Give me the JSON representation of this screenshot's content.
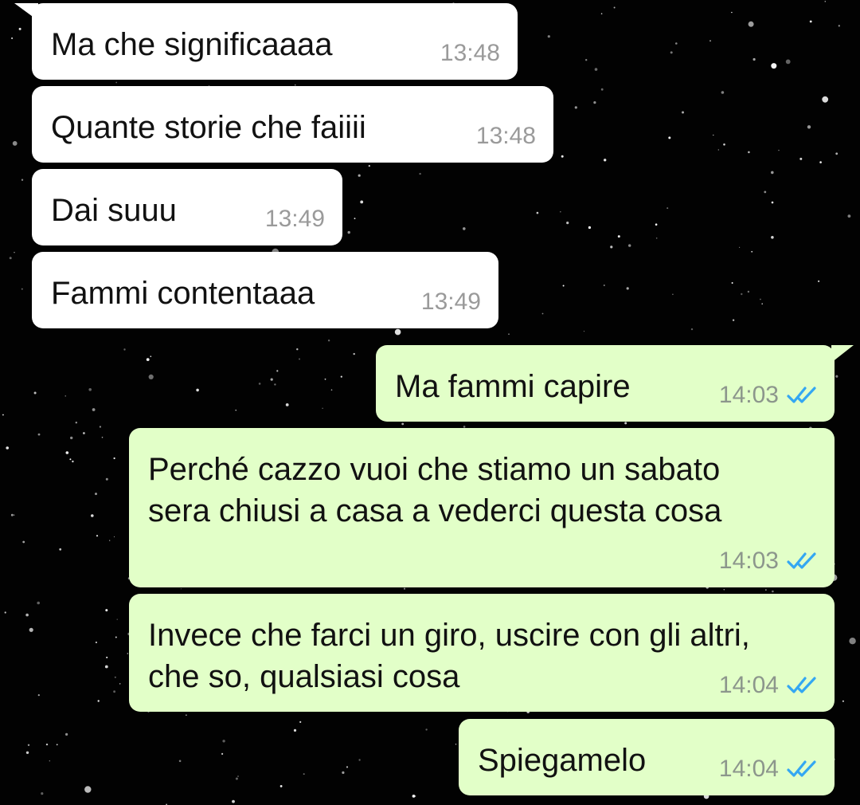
{
  "colors": {
    "background": "#020202",
    "incoming_bubble": "#ffffff",
    "outgoing_bubble": "#e2ffc8",
    "timestamp": "#8c968c",
    "read_ticks": "#34a7f2"
  },
  "messages": [
    {
      "direction": "incoming",
      "text": "Ma che significaaaa",
      "time": "13:48"
    },
    {
      "direction": "incoming",
      "text": "Quante storie che faiiii",
      "time": "13:48"
    },
    {
      "direction": "incoming",
      "text": "Dai suuu",
      "time": "13:49"
    },
    {
      "direction": "incoming",
      "text": "Fammi contentaaa",
      "time": "13:49"
    },
    {
      "direction": "outgoing",
      "text": "Ma fammi capire",
      "time": "14:03",
      "status_icon": "double-check-read-icon"
    },
    {
      "direction": "outgoing",
      "text": "Perché cazzo vuoi che stiamo un sabato\nsera chiusi a casa a vederci questa cosa",
      "time": "14:03",
      "status_icon": "double-check-read-icon"
    },
    {
      "direction": "outgoing",
      "text": "Invece che farci un giro, uscire con gli altri,\nche so, qualsiasi cosa",
      "time": "14:04",
      "status_icon": "double-check-read-icon"
    },
    {
      "direction": "outgoing",
      "text": "Spiegamelo",
      "time": "14:04",
      "status_icon": "double-check-read-icon"
    }
  ]
}
